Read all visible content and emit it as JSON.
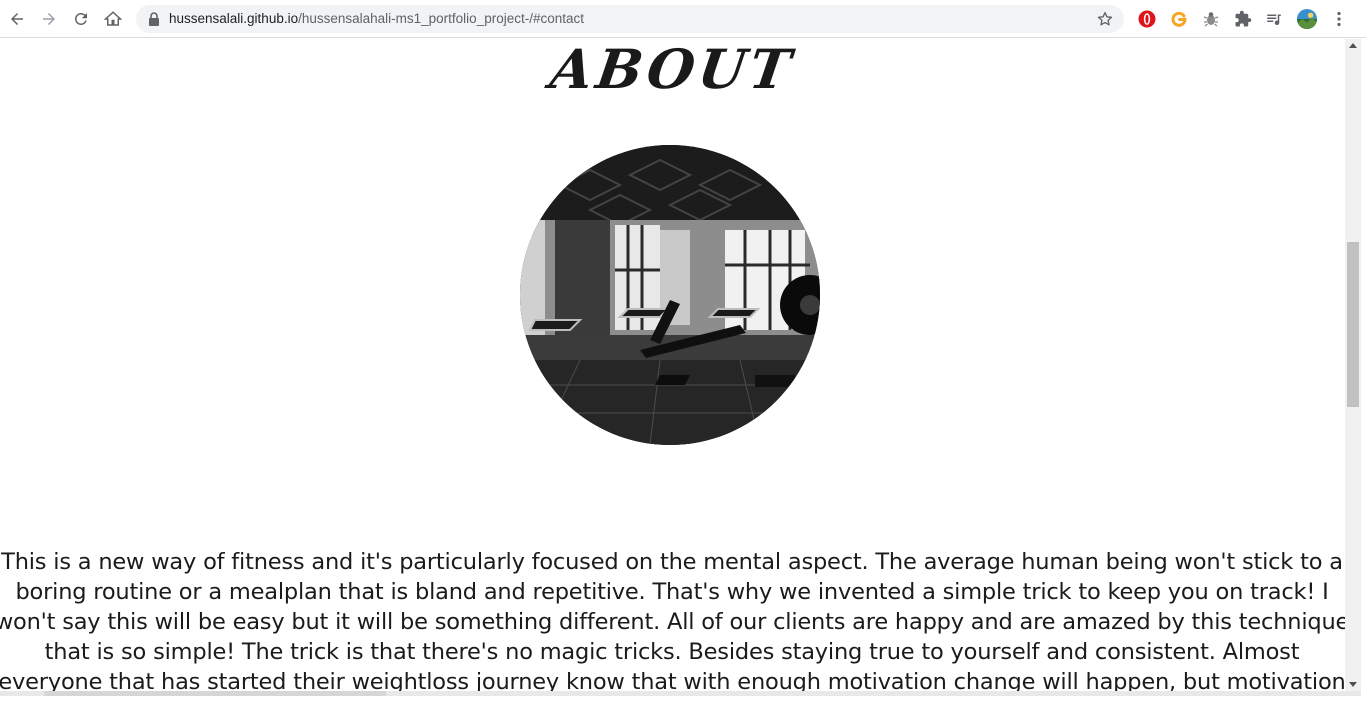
{
  "browser": {
    "url_domain": "hussensalali.github.io",
    "url_path": "/hussensalahali-ms1_portfolio_project-/#contact"
  },
  "page": {
    "section_title": "ABOUT",
    "about_text": "This is a new way of fitness and it's particularly focused on the mental aspect. The average human being won't stick to a boring routine or a mealplan that is bland and repetitive. That's why we invented a simple trick to keep you on track! I won't say this will be easy but it will be something different. All of our clients are happy and are amazed by this technique that is so simple! The trick is that there's no magic tricks. Besides staying true to yourself and consistent. Almost everyone that has started their weightloss journey know that with enough motivation change will happen, but motivation alone will only take you so far. We have"
  },
  "icons": {
    "back": "arrow-left-icon",
    "forward": "arrow-right-icon",
    "reload": "reload-icon",
    "home": "home-icon",
    "lock": "lock-icon",
    "bookmark": "star-icon",
    "opera": "opera-extension-icon",
    "grammarly": "grammarly-extension-icon",
    "bug": "bug-extension-icon",
    "extensions": "puzzle-icon",
    "media": "media-playlist-icon",
    "profile": "avatar",
    "menu": "kebab-menu-icon"
  },
  "colors": {
    "chrome_bg": "#ffffff",
    "omnibox_bg": "#f1f3f4",
    "text": "#1b1b1b",
    "opera_red": "#e0151b",
    "grammarly": "#f5a623"
  }
}
